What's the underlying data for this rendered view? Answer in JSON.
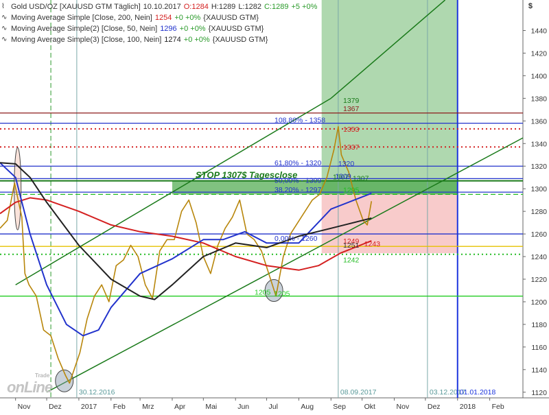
{
  "header": {
    "instrument": "Gold USD/OZ [XAUUSD GTM  Täglich]",
    "date": "10.10.2017",
    "open": "O:1284",
    "high": "H:1289",
    "low": "L:1282",
    "close": "C:1289",
    "change": "+5 +0%"
  },
  "indicators": [
    {
      "name": "Moving Average Simple [Close, 200, Nein]",
      "value": "1254",
      "change": "+0 +0%",
      "symbol": "{XAUUSD GTM}",
      "color": "#d42020"
    },
    {
      "name": "Moving Average Simple(2) [Close, 50, Nein]",
      "value": "1296",
      "change": "+0 +0%",
      "symbol": "{XAUUSD GTM}",
      "color": "#2233cc"
    },
    {
      "name": "Moving Average Simple(3) [Close, 100, Nein]",
      "value": "1274",
      "change": "+0 +0%",
      "symbol": "{XAUUSD GTM}",
      "color": "#222222"
    }
  ],
  "currency_symbol": "$",
  "watermark": {
    "small": "Trade",
    "big": "onLine"
  },
  "chart_data": {
    "type": "line",
    "title": "Gold USD/OZ [XAUUSD GTM  Täglich]",
    "ylim": [
      1115,
      1467
    ],
    "yticks": [
      1120,
      1140,
      1160,
      1180,
      1200,
      1220,
      1240,
      1260,
      1280,
      1300,
      1320,
      1340,
      1360,
      1380,
      1400,
      1420,
      1440
    ],
    "xlim": [
      "2016-10-17",
      "2018-03-05"
    ],
    "x_tick_labels": [
      {
        "date": "2016-11-01",
        "label": "Nov"
      },
      {
        "date": "2016-12-01",
        "label": "Dez"
      },
      {
        "date": "2017-01-01",
        "label": "2017"
      },
      {
        "date": "2017-02-01",
        "label": "Feb"
      },
      {
        "date": "2017-03-01",
        "label": "Mrz"
      },
      {
        "date": "2017-04-01",
        "label": "Apr"
      },
      {
        "date": "2017-05-01",
        "label": "Mai"
      },
      {
        "date": "2017-06-01",
        "label": "Jun"
      },
      {
        "date": "2017-07-01",
        "label": "Jul"
      },
      {
        "date": "2017-08-01",
        "label": "Aug"
      },
      {
        "date": "2017-09-01",
        "label": "Sep"
      },
      {
        "date": "2017-10-01",
        "label": "Okt"
      },
      {
        "date": "2017-11-01",
        "label": "Nov"
      },
      {
        "date": "2017-12-01",
        "label": "Dez"
      },
      {
        "date": "2018-01-01",
        "label": "2018"
      },
      {
        "date": "2018-02-01",
        "label": "Feb"
      }
    ],
    "grid": true,
    "series": [
      {
        "name": "Gold USD/OZ",
        "color": "#b8860b",
        "points": [
          [
            "2016-10-17",
            1265
          ],
          [
            "2016-10-24",
            1272
          ],
          [
            "2016-10-31",
            1305
          ],
          [
            "2016-11-07",
            1275
          ],
          [
            "2016-11-10",
            1225
          ],
          [
            "2016-11-14",
            1215
          ],
          [
            "2016-11-21",
            1205
          ],
          [
            "2016-11-28",
            1175
          ],
          [
            "2016-12-05",
            1170
          ],
          [
            "2016-12-12",
            1150
          ],
          [
            "2016-12-19",
            1135
          ],
          [
            "2016-12-23",
            1128
          ],
          [
            "2017-01-02",
            1155
          ],
          [
            "2017-01-09",
            1185
          ],
          [
            "2017-01-16",
            1205
          ],
          [
            "2017-01-23",
            1215
          ],
          [
            "2017-01-30",
            1200
          ],
          [
            "2017-02-06",
            1232
          ],
          [
            "2017-02-13",
            1237
          ],
          [
            "2017-02-20",
            1250
          ],
          [
            "2017-02-27",
            1240
          ],
          [
            "2017-03-06",
            1215
          ],
          [
            "2017-03-13",
            1203
          ],
          [
            "2017-03-20",
            1245
          ],
          [
            "2017-03-27",
            1255
          ],
          [
            "2017-04-03",
            1255
          ],
          [
            "2017-04-10",
            1280
          ],
          [
            "2017-04-17",
            1290
          ],
          [
            "2017-04-24",
            1270
          ],
          [
            "2017-05-01",
            1240
          ],
          [
            "2017-05-08",
            1225
          ],
          [
            "2017-05-15",
            1250
          ],
          [
            "2017-05-22",
            1265
          ],
          [
            "2017-05-29",
            1275
          ],
          [
            "2017-06-05",
            1290
          ],
          [
            "2017-06-12",
            1260
          ],
          [
            "2017-06-19",
            1255
          ],
          [
            "2017-06-26",
            1245
          ],
          [
            "2017-07-03",
            1225
          ],
          [
            "2017-07-10",
            1205
          ],
          [
            "2017-07-17",
            1240
          ],
          [
            "2017-07-24",
            1260
          ],
          [
            "2017-07-31",
            1270
          ],
          [
            "2017-08-07",
            1280
          ],
          [
            "2017-08-14",
            1290
          ],
          [
            "2017-08-21",
            1295
          ],
          [
            "2017-08-28",
            1310
          ],
          [
            "2017-09-04",
            1335
          ],
          [
            "2017-09-08",
            1355
          ],
          [
            "2017-09-11",
            1330
          ],
          [
            "2017-09-18",
            1315
          ],
          [
            "2017-09-25",
            1290
          ],
          [
            "2017-10-02",
            1272
          ],
          [
            "2017-10-06",
            1268
          ],
          [
            "2017-10-10",
            1289
          ]
        ]
      },
      {
        "name": "Moving Average Simple [Close, 200, Nein]",
        "color": "#d42020",
        "points": [
          [
            "2016-10-17",
            1278
          ],
          [
            "2016-11-01",
            1288
          ],
          [
            "2016-11-15",
            1292
          ],
          [
            "2016-12-01",
            1290
          ],
          [
            "2017-01-01",
            1280
          ],
          [
            "2017-02-01",
            1268
          ],
          [
            "2017-03-01",
            1262
          ],
          [
            "2017-04-01",
            1258
          ],
          [
            "2017-05-01",
            1252
          ],
          [
            "2017-06-01",
            1240
          ],
          [
            "2017-07-01",
            1232
          ],
          [
            "2017-08-01",
            1228
          ],
          [
            "2017-08-20",
            1232
          ],
          [
            "2017-09-10",
            1243
          ],
          [
            "2017-10-10",
            1254
          ]
        ]
      },
      {
        "name": "Moving Average Simple(2) [Close, 50, Nein]",
        "color": "#2233cc",
        "points": [
          [
            "2016-10-17",
            1323
          ],
          [
            "2016-11-01",
            1310
          ],
          [
            "2016-11-15",
            1260
          ],
          [
            "2016-12-01",
            1215
          ],
          [
            "2016-12-20",
            1180
          ],
          [
            "2017-01-05",
            1170
          ],
          [
            "2017-01-20",
            1175
          ],
          [
            "2017-02-01",
            1195
          ],
          [
            "2017-03-01",
            1225
          ],
          [
            "2017-04-01",
            1238
          ],
          [
            "2017-05-01",
            1255
          ],
          [
            "2017-05-20",
            1255
          ],
          [
            "2017-06-10",
            1262
          ],
          [
            "2017-07-01",
            1252
          ],
          [
            "2017-08-01",
            1252
          ],
          [
            "2017-09-01",
            1282
          ],
          [
            "2017-10-10",
            1296
          ]
        ]
      },
      {
        "name": "Moving Average Simple(3) [Close, 100, Nein]",
        "color": "#222222",
        "points": [
          [
            "2016-10-17",
            1323
          ],
          [
            "2016-11-01",
            1322
          ],
          [
            "2016-11-15",
            1310
          ],
          [
            "2016-12-01",
            1288
          ],
          [
            "2017-01-01",
            1250
          ],
          [
            "2017-02-01",
            1220
          ],
          [
            "2017-03-01",
            1205
          ],
          [
            "2017-03-15",
            1202
          ],
          [
            "2017-04-01",
            1215
          ],
          [
            "2017-05-01",
            1240
          ],
          [
            "2017-06-01",
            1252
          ],
          [
            "2017-07-01",
            1248
          ],
          [
            "2017-08-01",
            1258
          ],
          [
            "2017-09-01",
            1265
          ],
          [
            "2017-10-10",
            1274
          ]
        ]
      }
    ],
    "horizontal_lines": [
      {
        "y": 1367,
        "color": "#8b1a1a",
        "style": "solid",
        "label": "1367"
      },
      {
        "y": 1353,
        "color": "#d42020",
        "style": "dotted",
        "label": "1353"
      },
      {
        "y": 1337,
        "color": "#d42020",
        "style": "dotted",
        "label": "1337"
      },
      {
        "y": 1358,
        "color": "#2233cc",
        "style": "solid",
        "label": "108,80% - 1358"
      },
      {
        "y": 1320,
        "color": "#2233cc",
        "style": "solid",
        "label": "61,80% - 1320"
      },
      {
        "y": 1309,
        "color": "#2233cc",
        "style": "solid",
        "label": "50,00% - 1309"
      },
      {
        "y": 1297,
        "color": "#2233cc",
        "style": "solid",
        "label": "38,20% - 1297"
      },
      {
        "y": 1260,
        "color": "#2233cc",
        "style": "solid",
        "label": "0,00% - 1260"
      },
      {
        "y": 1307,
        "color": "#1a7a1a",
        "style": "solid",
        "label": "1307"
      },
      {
        "y": 1295,
        "color": "#22bb22",
        "style": "dashed",
        "label": "1295"
      },
      {
        "y": 1249,
        "color": "#e6c200",
        "style": "solid",
        "label": "1249"
      },
      {
        "y": 1242,
        "color": "#22bb22",
        "style": "dotted",
        "label": "1242"
      },
      {
        "y": 1205,
        "color": "#22cc22",
        "style": "solid",
        "label": "1205"
      }
    ],
    "zones": [
      {
        "x": [
          "2017-08-23",
          "2018-01-01"
        ],
        "y": [
          1295,
          1467
        ],
        "color": "#6db86d",
        "label": "1379"
      },
      {
        "x": [
          "2017-08-23",
          "2018-01-01"
        ],
        "y": [
          1243,
          1295
        ],
        "color": "#f2a0a0",
        "label": "1251"
      }
    ],
    "stop_box": {
      "x": [
        "2017-04-01",
        "2018-01-01"
      ],
      "y": [
        1295,
        1307
      ],
      "color": "#4aa84a",
      "label": "STOP 1307$ Tagesclose"
    },
    "trend_channel": [
      {
        "from": [
          "2016-11-01",
          1215
        ],
        "to": [
          "2017-09-01",
          1380
        ],
        "color": "#1a7a1a"
      },
      {
        "from": [
          "2016-12-01",
          1120
        ],
        "to": [
          "2018-03-05",
          1345
        ],
        "color": "#1a7a1a"
      },
      {
        "from": [
          "2017-09-01",
          1380
        ],
        "to": [
          "2017-12-20",
          1467
        ],
        "color": "#1a7a1a"
      }
    ],
    "vertical_lines": [
      {
        "date": "2016-12-30",
        "label": "30.12.2016",
        "color": "#7aa8a8",
        "style": "solid"
      },
      {
        "date": "2017-09-08",
        "label": "08.09.2017",
        "color": "#7aa8a8",
        "style": "solid"
      },
      {
        "date": "2017-12-03",
        "label": "03.12.2017",
        "color": "#7aa8a8",
        "style": "solid"
      },
      {
        "date": "2018-01-01",
        "label": "01.01.2018",
        "color": "#1a33dd",
        "style": "solid"
      },
      {
        "date": "2016-12-05",
        "label": "",
        "color": "#2a9a2a",
        "style": "dashed"
      }
    ],
    "markers": [
      {
        "type": "ellipse",
        "at": [
          "2016-11-03",
          1300
        ],
        "color": "#f4c0b0"
      },
      {
        "type": "ellipse",
        "at": [
          "2016-12-18",
          1130
        ],
        "color": "#8899aa"
      },
      {
        "type": "ellipse",
        "at": [
          "2017-07-08",
          1210
        ],
        "color": "#8899aa"
      }
    ],
    "marker_labels": [
      {
        "text": "1205",
        "at": [
          "2017-07-08",
          1205
        ],
        "color": "#22cc22"
      },
      {
        "text": "1243",
        "at": [
          "2017-10-03",
          1249
        ],
        "color": "#d42020"
      },
      {
        "text": "1307",
        "at": [
          "2017-09-22",
          1307
        ],
        "color": "#1a7a1a"
      },
      {
        "text": "1320",
        "at": [
          "2017-09-08",
          1320
        ],
        "color": "#2233cc"
      },
      {
        "text": "1309",
        "at": [
          "2017-09-05",
          1309
        ],
        "color": "#2233cc"
      }
    ]
  }
}
